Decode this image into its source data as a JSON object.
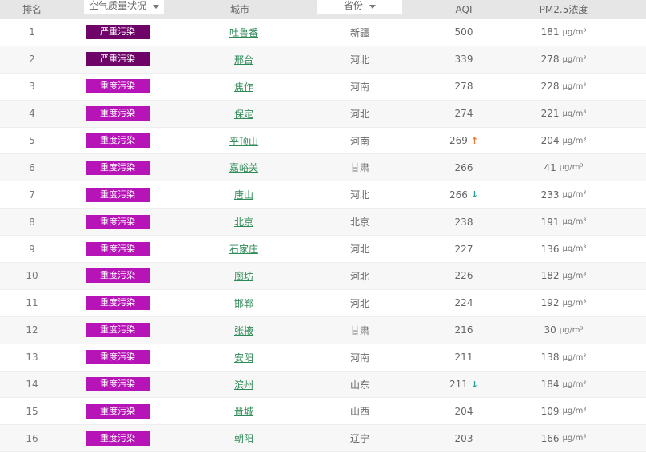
{
  "header": {
    "rank": "排名",
    "status": "空气质量状况",
    "city": "城市",
    "province": "省份",
    "aqi": "AQI",
    "pm25": "PM2.5浓度"
  },
  "unit": "μg/m³",
  "trend_symbols": {
    "up": "↑",
    "down": "↓"
  },
  "colors": {
    "up": "#e8732a",
    "down": "#2aa39a"
  },
  "rows": [
    {
      "rank": "1",
      "status": "严重污染",
      "status_color": "#6e0368",
      "city": "吐鲁番",
      "province": "新疆",
      "aqi": "500",
      "pm25": "181",
      "trend": ""
    },
    {
      "rank": "2",
      "status": "严重污染",
      "status_color": "#6e0368",
      "city": "邢台",
      "province": "河北",
      "aqi": "339",
      "pm25": "278",
      "trend": ""
    },
    {
      "rank": "3",
      "status": "重度污染",
      "status_color": "#b614b7",
      "city": "焦作",
      "province": "河南",
      "aqi": "278",
      "pm25": "228",
      "trend": ""
    },
    {
      "rank": "4",
      "status": "重度污染",
      "status_color": "#b614b7",
      "city": "保定",
      "province": "河北",
      "aqi": "274",
      "pm25": "221",
      "trend": ""
    },
    {
      "rank": "5",
      "status": "重度污染",
      "status_color": "#b614b7",
      "city": "平顶山",
      "province": "河南",
      "aqi": "269",
      "pm25": "204",
      "trend": "up"
    },
    {
      "rank": "6",
      "status": "重度污染",
      "status_color": "#b614b7",
      "city": "嘉峪关",
      "province": "甘肃",
      "aqi": "266",
      "pm25": "41",
      "trend": ""
    },
    {
      "rank": "7",
      "status": "重度污染",
      "status_color": "#b614b7",
      "city": "唐山",
      "province": "河北",
      "aqi": "266",
      "pm25": "233",
      "trend": "down"
    },
    {
      "rank": "8",
      "status": "重度污染",
      "status_color": "#b614b7",
      "city": "北京",
      "province": "北京",
      "aqi": "238",
      "pm25": "191",
      "trend": ""
    },
    {
      "rank": "9",
      "status": "重度污染",
      "status_color": "#b614b7",
      "city": "石家庄",
      "province": "河北",
      "aqi": "227",
      "pm25": "136",
      "trend": ""
    },
    {
      "rank": "10",
      "status": "重度污染",
      "status_color": "#b614b7",
      "city": "廊坊",
      "province": "河北",
      "aqi": "226",
      "pm25": "182",
      "trend": ""
    },
    {
      "rank": "11",
      "status": "重度污染",
      "status_color": "#b614b7",
      "city": "邯郸",
      "province": "河北",
      "aqi": "224",
      "pm25": "192",
      "trend": ""
    },
    {
      "rank": "12",
      "status": "重度污染",
      "status_color": "#b614b7",
      "city": "张掖",
      "province": "甘肃",
      "aqi": "216",
      "pm25": "30",
      "trend": ""
    },
    {
      "rank": "13",
      "status": "重度污染",
      "status_color": "#b614b7",
      "city": "安阳",
      "province": "河南",
      "aqi": "211",
      "pm25": "138",
      "trend": ""
    },
    {
      "rank": "14",
      "status": "重度污染",
      "status_color": "#b614b7",
      "city": "滨州",
      "province": "山东",
      "aqi": "211",
      "pm25": "184",
      "trend": "down"
    },
    {
      "rank": "15",
      "status": "重度污染",
      "status_color": "#b614b7",
      "city": "晋城",
      "province": "山西",
      "aqi": "204",
      "pm25": "109",
      "trend": ""
    },
    {
      "rank": "16",
      "status": "重度污染",
      "status_color": "#b614b7",
      "city": "朝阳",
      "province": "辽宁",
      "aqi": "203",
      "pm25": "166",
      "trend": ""
    }
  ]
}
